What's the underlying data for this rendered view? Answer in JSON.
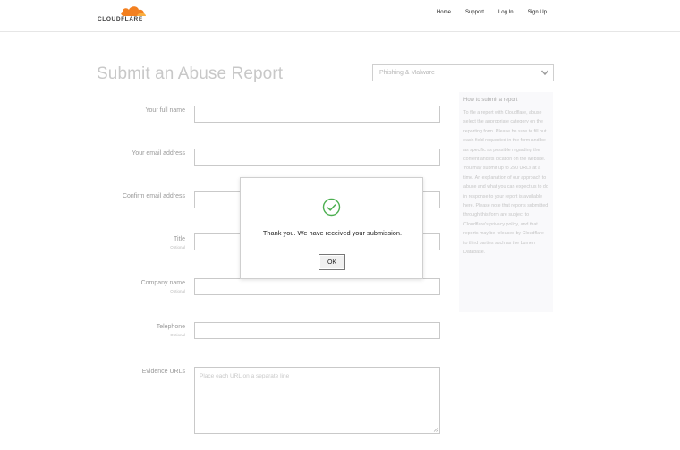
{
  "header": {
    "logo_text": "CLOUDFLARE",
    "nav": [
      {
        "label": "Home"
      },
      {
        "label": "Support"
      },
      {
        "label": "Log In"
      },
      {
        "label": "Sign Up"
      }
    ]
  },
  "page": {
    "title": "Submit an Abuse Report",
    "category_selected": "Phishing & Malware"
  },
  "form": {
    "full_name": {
      "label": "Your full name",
      "value": ""
    },
    "email": {
      "label": "Your email address",
      "value": ""
    },
    "confirm_email": {
      "label": "Confirm email address",
      "value": ""
    },
    "title": {
      "label": "Title",
      "sub": "Optional",
      "value": ""
    },
    "company": {
      "label": "Company name",
      "sub": "Optional",
      "value": ""
    },
    "telephone": {
      "label": "Telephone",
      "sub": "Optional",
      "value": ""
    },
    "evidence": {
      "label": "Evidence URLs",
      "placeholder": "Place each URL on a separate line"
    }
  },
  "help": {
    "title": "How to submit a report",
    "body": "To file a report with Cloudflare, abuse select the appropriate category on the reporting form. Please be sure to fill out each field requested in the form and be as specific as possible regarding the content and its location on the website. You may submit up to 250 URLs at a time. An explanation of our approach to abuse and what you can expect us to do in response to your report is available here. Please note that reports submitted through this form are subject to Cloudflare's privacy policy, and that reports may be released by Cloudflare to third parties such as the Lumen Database."
  },
  "modal": {
    "message": "Thank you. We have received your submission.",
    "ok_label": "OK"
  },
  "colors": {
    "brand_orange": "#f38020",
    "success_green": "#4caf50"
  }
}
